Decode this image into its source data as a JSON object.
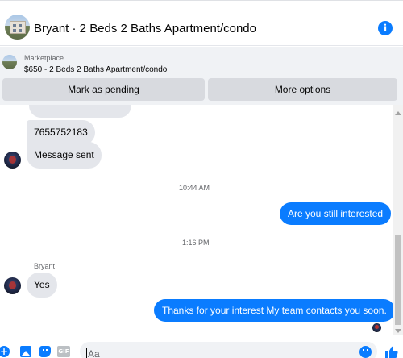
{
  "header": {
    "title": "Bryant · 2 Beds 2 Baths Apartment/condo",
    "info_glyph": "i"
  },
  "marketplace": {
    "label": "Marketplace",
    "listing": "$650 - 2 Beds 2 Baths Apartment/condo",
    "buttons": {
      "pending": "Mark as pending",
      "more": "More options"
    }
  },
  "conversation": {
    "messages": [
      {
        "from": "them",
        "text": "7655752183"
      },
      {
        "from": "them",
        "text": "Message sent"
      },
      {
        "from": "me",
        "text": "Are you still interested"
      },
      {
        "from": "them",
        "text": "Yes"
      },
      {
        "from": "me",
        "text": "Thanks for your  interest My team contacts you soon."
      }
    ],
    "timestamps": [
      "10:44 AM",
      "1:16 PM"
    ],
    "sender_name": "Bryant"
  },
  "composer": {
    "placeholder": "Aa",
    "gif_label": "GIF",
    "plus_glyph": "+"
  },
  "icons": [
    "info-icon",
    "plus-icon",
    "image-icon",
    "sticker-icon",
    "gif-icon",
    "emoji-icon",
    "like-icon"
  ],
  "colors": {
    "accent": "#0a7cff",
    "incoming_bubble": "#e4e6eb",
    "panel": "#f0f2f5"
  }
}
